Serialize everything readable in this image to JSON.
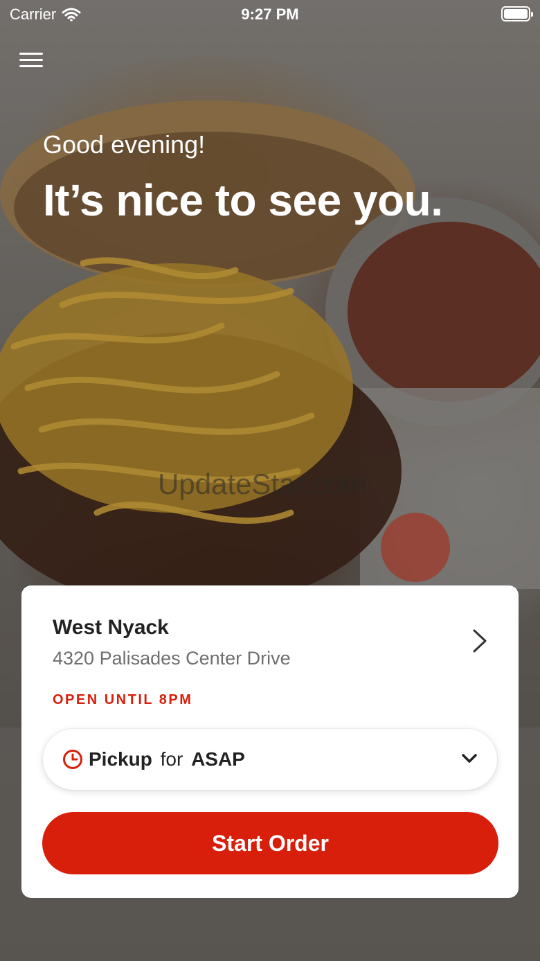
{
  "status_bar": {
    "carrier": "Carrier",
    "time": "9:27 PM"
  },
  "hero": {
    "greeting": "Good evening!",
    "headline": "It’s nice to see you.",
    "watermark": "UpdateStar.com"
  },
  "store_card": {
    "name": "West Nyack",
    "address": "4320 Palisades Center Drive",
    "open_status": "OPEN UNTIL 8PM",
    "order_type": {
      "mode": "Pickup",
      "connector": "for",
      "time": "ASAP"
    },
    "start_label": "Start Order"
  },
  "colors": {
    "accent": "#d81f0b",
    "card_bg": "#ffffff"
  }
}
